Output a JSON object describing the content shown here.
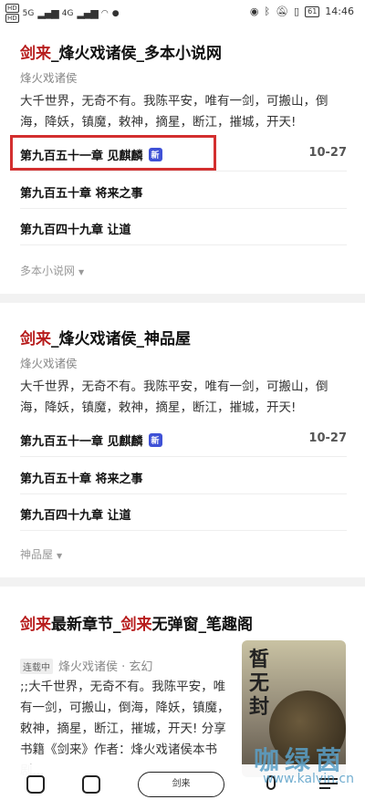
{
  "status_bar": {
    "hd1": "HD",
    "hd2": "HD",
    "net1": "5G",
    "net2": "4G",
    "battery": "61",
    "time": "14:46"
  },
  "cards": [
    {
      "title_kw": "剑来",
      "title_rest": "_烽火戏诸侯_多本小说网",
      "author": "烽火戏诸侯",
      "desc": "大千世界，无奇不有。我陈平安，唯有一剑，可搬山，倒海，降妖，镇魔，敕神，摘星，断江，摧城，开天!",
      "chapters": [
        {
          "name": "第九百五十一章 见麒麟",
          "badge": "新",
          "date": "10-27"
        },
        {
          "name": "第九百五十章 将来之事",
          "date": ""
        },
        {
          "name": "第九百四十九章 让道",
          "date": ""
        }
      ],
      "source": "多本小说网"
    },
    {
      "title_kw": "剑来",
      "title_rest": "_烽火戏诸侯_神品屋",
      "author": "烽火戏诸侯",
      "desc": "大千世界，无奇不有。我陈平安，唯有一剑，可搬山，倒海，降妖，镇魔，敕神，摘星，断江，摧城，开天!",
      "chapters": [
        {
          "name": "第九百五十一章 见麒麟",
          "badge": "新",
          "date": "10-27"
        },
        {
          "name": "第九百五十章 将来之事",
          "date": ""
        },
        {
          "name": "第九百四十九章 让道",
          "date": ""
        }
      ],
      "source": "神品屋"
    }
  ],
  "card3": {
    "title_kw1": "剑来",
    "title_mid": "最新章节_",
    "title_kw2": "剑来",
    "title_rest": "无弹窗_笔趣阁",
    "status": "连载中",
    "meta": "烽火戏诸侯 · 玄幻",
    "desc": ";;大千世界，无奇不有。我陈平安，唯有一剑，可搬山，倒海，降妖，镇魔，敕神，摘星，断江，摧城，开天! 分享书籍《剑来》作者：烽火戏诸侯本书剧...",
    "cover_text": "皙无封",
    "cover_icon": "book-cover-image"
  },
  "bottom_bar": {
    "search_label": "剑来"
  },
  "watermark": {
    "text": "咖绿茵",
    "url": "www.kalvin.cn"
  },
  "colors": {
    "accent": "#b71c1c",
    "badge": "#3f51d6",
    "highlight": "#d32f2f"
  }
}
